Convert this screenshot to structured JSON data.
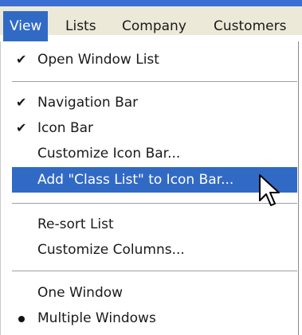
{
  "menubar": {
    "items": [
      {
        "label": "View",
        "active": true
      },
      {
        "label": "Lists",
        "active": false
      },
      {
        "label": "Company",
        "active": false
      },
      {
        "label": "Customers",
        "active": false
      }
    ]
  },
  "menu": {
    "items": [
      {
        "label": "Open Window List",
        "marker": "check"
      },
      {
        "label": "Navigation Bar",
        "marker": "check"
      },
      {
        "label": "Icon Bar",
        "marker": "check"
      },
      {
        "label": "Customize Icon Bar...",
        "marker": ""
      },
      {
        "label": "Add \"Class List\" to Icon Bar...",
        "marker": "",
        "highlighted": true
      },
      {
        "label": "Re-sort List",
        "marker": ""
      },
      {
        "label": "Customize Columns...",
        "marker": ""
      },
      {
        "label": "One Window",
        "marker": ""
      },
      {
        "label": "Multiple Windows",
        "marker": "bullet"
      }
    ]
  },
  "colors": {
    "highlight": "#316ac5",
    "menubar_bg": "#ece9d8",
    "title_strip": "#3c6fd4"
  }
}
